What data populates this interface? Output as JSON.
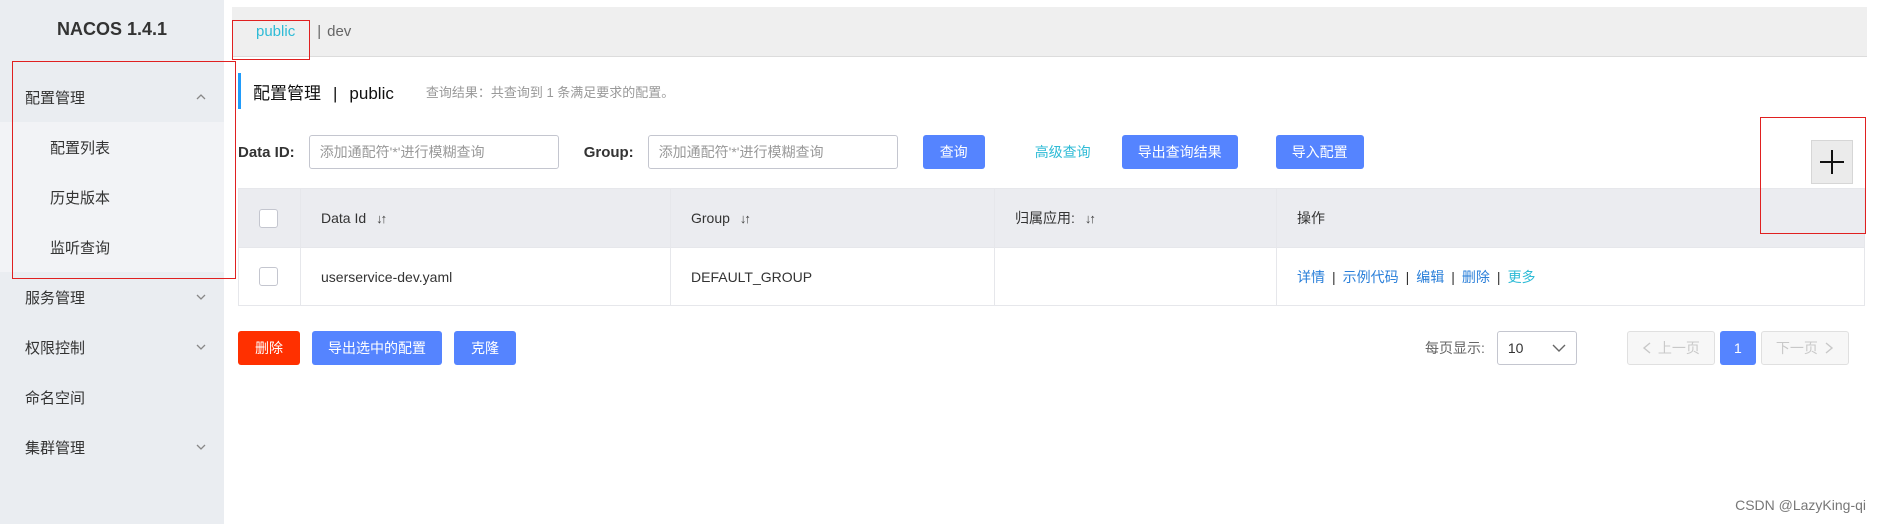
{
  "sidebar": {
    "brand": "NACOS 1.4.1",
    "groups": [
      {
        "label": "配置管理",
        "expanded": true,
        "items": [
          {
            "label": "配置列表"
          },
          {
            "label": "历史版本"
          },
          {
            "label": "监听查询"
          }
        ]
      },
      {
        "label": "服务管理",
        "expanded": false
      },
      {
        "label": "权限控制",
        "expanded": false
      },
      {
        "label": "命名空间"
      },
      {
        "label": "集群管理",
        "expanded": false
      }
    ]
  },
  "namespace_tabs": [
    {
      "label": "public",
      "active": true
    },
    {
      "label": "dev",
      "active": false
    }
  ],
  "tab_separator": "|",
  "page": {
    "title": "配置管理",
    "separator": "|",
    "namespace": "public",
    "query_result": "查询结果：共查询到 1 条满足要求的配置。"
  },
  "filters": {
    "data_id_label": "Data ID:",
    "data_id_placeholder": "添加通配符'*'进行模糊查询",
    "group_label": "Group:",
    "group_placeholder": "添加通配符'*'进行模糊查询",
    "query_button": "查询",
    "advanced_query": "高级查询",
    "export_results_button": "导出查询结果",
    "import_button": "导入配置",
    "add_button": "+"
  },
  "table": {
    "columns": [
      "Data Id",
      "Group",
      "归属应用:",
      "操作"
    ],
    "sort_icon": "↓↑",
    "rows": [
      {
        "data_id": "userservice-dev.yaml",
        "group": "DEFAULT_GROUP",
        "app": "",
        "operations": [
          "详情",
          "示例代码",
          "编辑",
          "删除",
          "更多"
        ]
      }
    ],
    "op_separator": "|"
  },
  "bottom": {
    "delete_button": "删除",
    "export_selected_button": "导出选中的配置",
    "clone_button": "克隆",
    "per_page_label": "每页显示:",
    "per_page_value": "10",
    "prev_button": "上一页",
    "current_page": "1",
    "next_button": "下一页"
  },
  "watermark": "CSDN @LazyKing-qi",
  "colors": {
    "primary": "#5584ff",
    "danger": "#ff3000",
    "link": "#2ebbd6",
    "annotation": "#e02020"
  }
}
